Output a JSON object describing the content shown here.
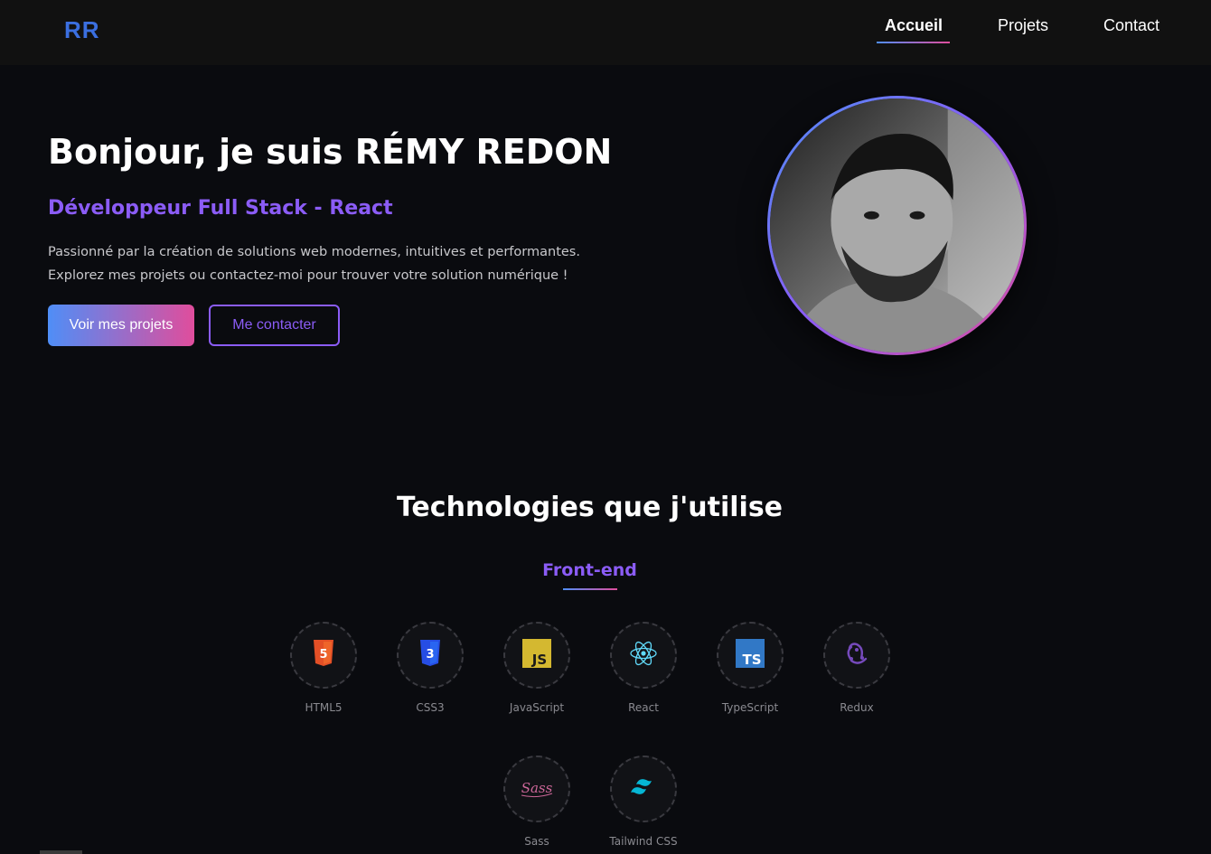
{
  "nav": {
    "logo": "RR",
    "links": [
      {
        "label": "Accueil",
        "active": true
      },
      {
        "label": "Projets",
        "active": false
      },
      {
        "label": "Contact",
        "active": false
      }
    ]
  },
  "hero": {
    "title": "Bonjour, je suis RÉMY REDON",
    "subtitle": "Développeur Full Stack - React",
    "description": "Passionné par la création de solutions web modernes, intuitives et performantes. Explorez mes projets ou contactez-moi pour trouver votre solution numérique !",
    "primary_button": "Voir mes projets",
    "secondary_button": "Me contacter"
  },
  "technologies": {
    "title": "Technologies que j'utilise",
    "category": "Front-end",
    "items": [
      {
        "label": "HTML5",
        "icon": "html5-icon"
      },
      {
        "label": "CSS3",
        "icon": "css3-icon"
      },
      {
        "label": "JavaScript",
        "icon": "javascript-icon"
      },
      {
        "label": "React",
        "icon": "react-icon"
      },
      {
        "label": "TypeScript",
        "icon": "typescript-icon"
      },
      {
        "label": "Redux",
        "icon": "redux-icon"
      },
      {
        "label": "Sass",
        "icon": "sass-icon"
      },
      {
        "label": "Tailwind CSS",
        "icon": "tailwind-icon"
      }
    ]
  },
  "colors": {
    "background": "#0a0b0f",
    "navbar": "#111111",
    "accent_purple": "#8b5cf6",
    "gradient_start": "#4f8ef7",
    "gradient_end": "#e04d9c",
    "logo": "#3b6fe0"
  }
}
